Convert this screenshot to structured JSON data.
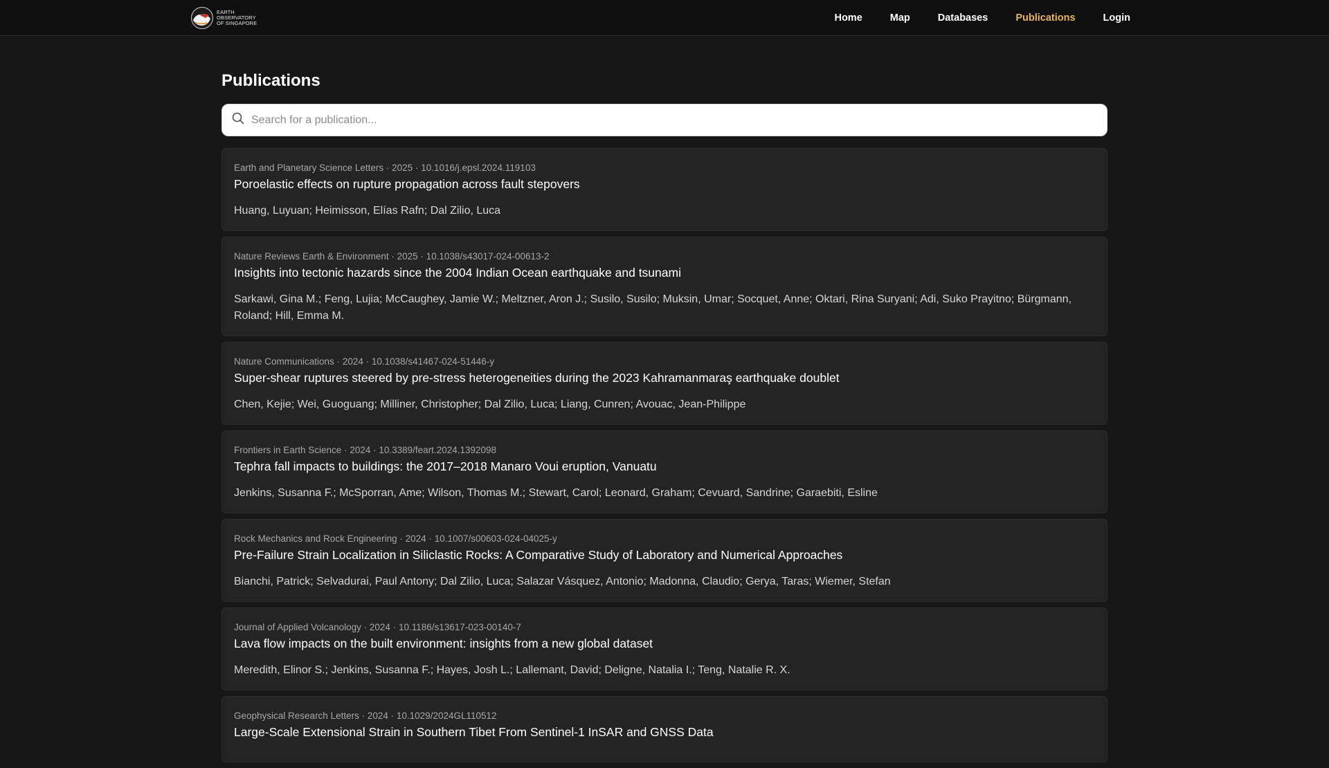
{
  "logo": {
    "line1": "EARTH",
    "line2": "OBSERVATORY",
    "line3": "OF SINGAPORE"
  },
  "nav": {
    "items": [
      {
        "label": "Home"
      },
      {
        "label": "Map"
      },
      {
        "label": "Databases"
      },
      {
        "label": "Publications"
      },
      {
        "label": "Login"
      }
    ],
    "active": "Publications",
    "active_color": "#e9b45f"
  },
  "page": {
    "title": "Publications"
  },
  "search": {
    "placeholder": "Search for a publication...",
    "value": "",
    "icon": "search-icon"
  },
  "publications": [
    {
      "journal": "Earth and Planetary Science Letters",
      "year": "2025",
      "doi": "10.1016/j.epsl.2024.119103",
      "title": "Poroelastic effects on rupture propagation across fault stepovers",
      "authors": "Huang, Luyuan; Heimisson, Elías Rafn; Dal Zilio, Luca"
    },
    {
      "journal": "Nature Reviews Earth & Environment",
      "year": "2025",
      "doi": "10.1038/s43017-024-00613-2",
      "title": "Insights into tectonic hazards since the 2004 Indian Ocean earthquake and tsunami",
      "authors": "Sarkawi, Gina M.; Feng, Lujia; McCaughey, Jamie W.; Meltzner, Aron J.; Susilo, Susilo; Muksin, Umar; Socquet, Anne; Oktari, Rina Suryani; Adi, Suko Prayitno; Bürgmann, Roland; Hill, Emma M."
    },
    {
      "journal": "Nature Communications",
      "year": "2024",
      "doi": "10.1038/s41467-024-51446-y",
      "title": "Super-shear ruptures steered by pre-stress heterogeneities during the 2023 Kahramanmaraş earthquake doublet",
      "authors": "Chen, Kejie; Wei, Guoguang; Milliner, Christopher; Dal Zilio, Luca; Liang, Cunren; Avouac, Jean-Philippe"
    },
    {
      "journal": "Frontiers in Earth Science",
      "year": "2024",
      "doi": "10.3389/feart.2024.1392098",
      "title": "Tephra fall impacts to buildings: the 2017–2018 Manaro Voui eruption, Vanuatu",
      "authors": "Jenkins, Susanna F.; McSporran, Ame; Wilson, Thomas M.; Stewart, Carol; Leonard, Graham; Cevuard, Sandrine; Garaebiti, Esline"
    },
    {
      "journal": "Rock Mechanics and Rock Engineering",
      "year": "2024",
      "doi": "10.1007/s00603-024-04025-y",
      "title": "Pre-Failure Strain Localization in Siliclastic Rocks: A Comparative Study of Laboratory and Numerical Approaches",
      "authors": "Bianchi, Patrick; Selvadurai, Paul Antony; Dal Zilio, Luca; Salazar Vásquez, Antonio; Madonna, Claudio; Gerya, Taras; Wiemer, Stefan"
    },
    {
      "journal": "Journal of Applied Volcanology",
      "year": "2024",
      "doi": "10.1186/s13617-023-00140-7",
      "title": "Lava flow impacts on the built environment: insights from a new global dataset",
      "authors": "Meredith, Elinor S.; Jenkins, Susanna F.; Hayes, Josh L.; Lallemant, David; Deligne, Natalia I.; Teng, Natalie R. X."
    },
    {
      "journal": "Geophysical Research Letters",
      "year": "2024",
      "doi": "10.1029/2024GL110512",
      "title": "Large-Scale Extensional Strain in Southern Tibet From Sentinel-1 InSAR and GNSS Data",
      "authors": ""
    }
  ]
}
